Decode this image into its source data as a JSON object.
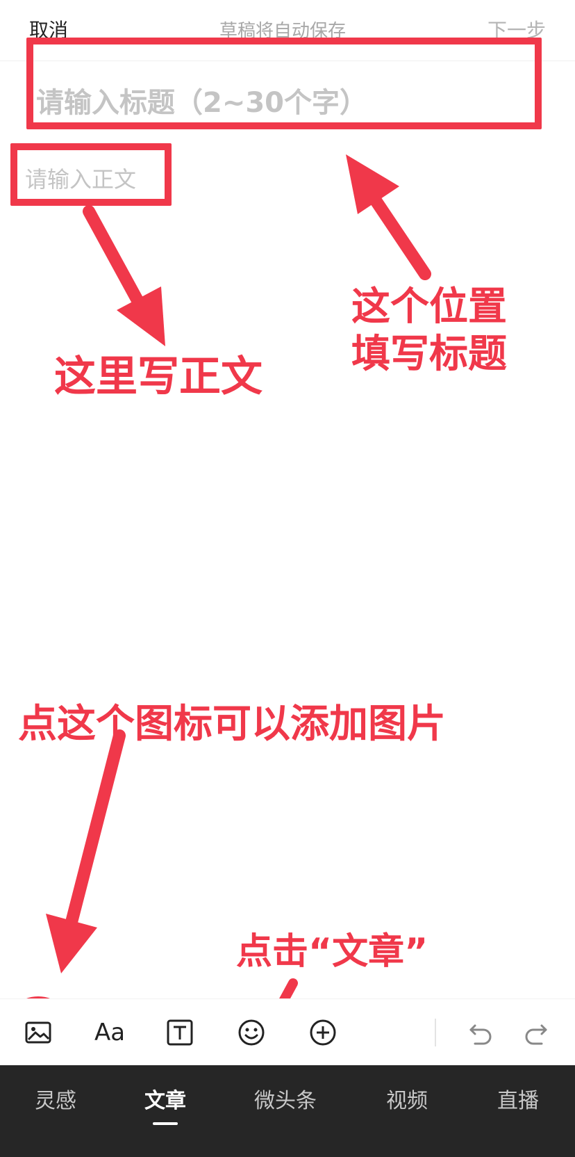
{
  "header": {
    "cancel_label": "取消",
    "autosave_text": "草稿将自动保存",
    "next_label": "下一步"
  },
  "editor": {
    "title_placeholder": "请输入标题（2~30个字）",
    "body_placeholder": "请输入正文"
  },
  "toolbar": {
    "tools": [
      {
        "icon": "image-icon"
      },
      {
        "icon": "font-size-icon",
        "label": "Aa"
      },
      {
        "icon": "text-box-icon"
      },
      {
        "icon": "emoji-icon"
      },
      {
        "icon": "plus-circle-icon"
      },
      {
        "icon": "undo-icon"
      },
      {
        "icon": "redo-icon"
      }
    ]
  },
  "bottom_nav": {
    "tabs": [
      {
        "label": "灵感"
      },
      {
        "label": "文章",
        "active": true
      },
      {
        "label": "微头条"
      },
      {
        "label": "视频"
      },
      {
        "label": "直播"
      }
    ]
  },
  "annotations": {
    "title_hint_line1": "这个位置",
    "title_hint_line2": "填写标题",
    "body_hint": "这里写正文",
    "image_hint": "点这个图标可以添加图片",
    "article_hint": "点击“文章”"
  },
  "colors": {
    "annotation_red": "#f0384a",
    "nav_background": "#262626"
  }
}
